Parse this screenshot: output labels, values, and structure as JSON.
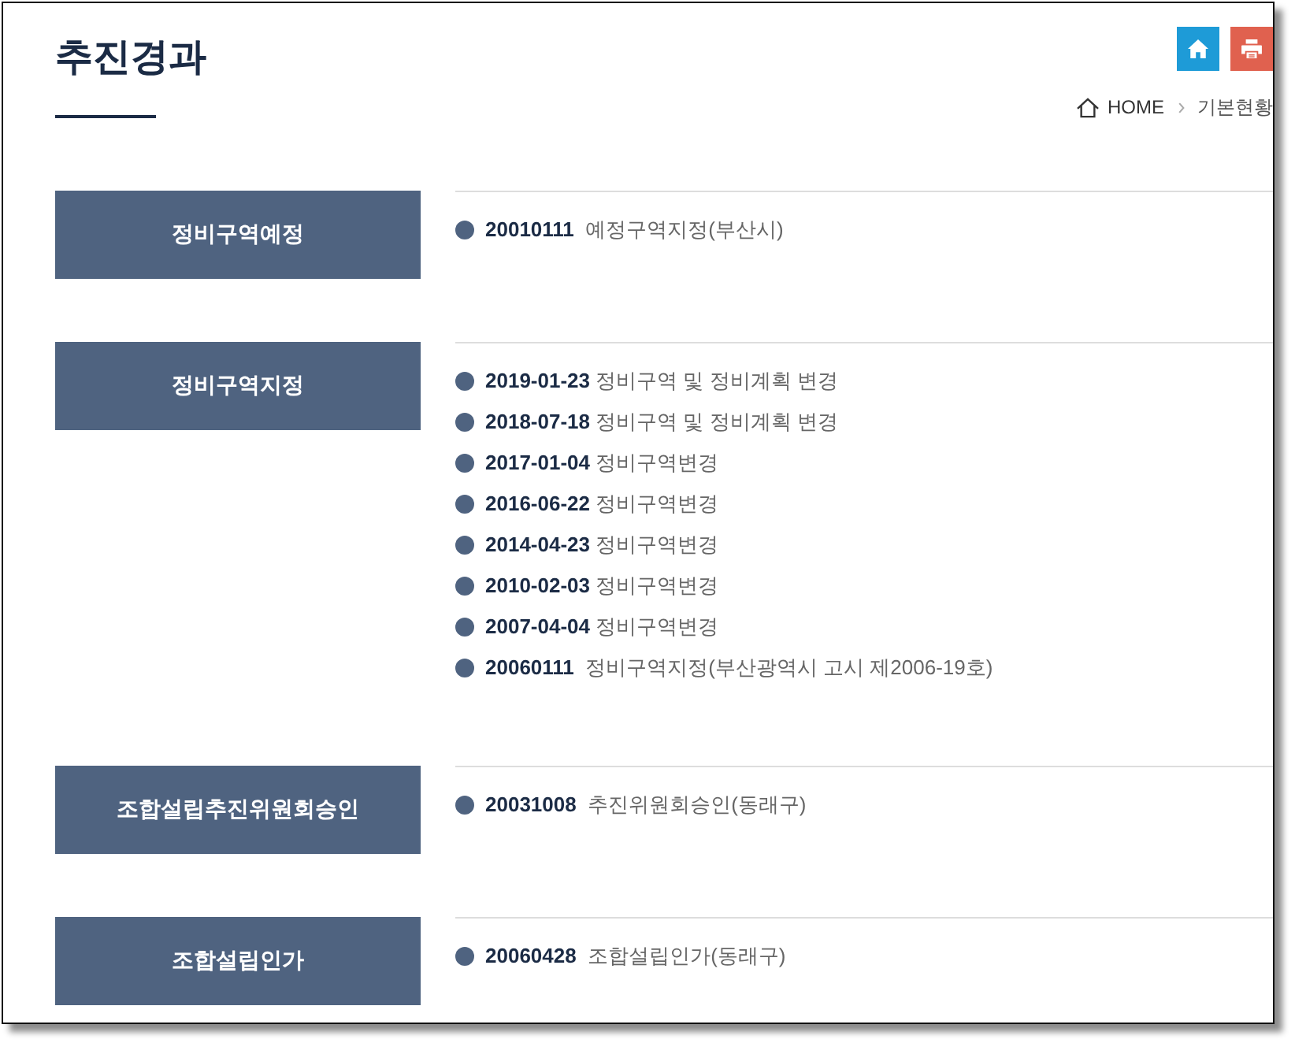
{
  "page": {
    "title": "추진경과"
  },
  "breadcrumb": [
    "HOME",
    "기본현황"
  ],
  "sections": [
    {
      "label": "정비구역예정",
      "entries": [
        "**20010111**  예정구역지정(부산시)"
      ]
    },
    {
      "label": "정비구역지정",
      "entries": [
        "**2019-01-23** 정비구역 및 정비계획 변경",
        "**2018-07-18** 정비구역 및 정비계획 변경",
        "**2017-01-04** 정비구역변경",
        "**2016-06-22** 정비구역변경",
        "**2014-04-23** 정비구역변경",
        "**2010-02-03** 정비구역변경",
        "**2007-04-04** 정비구역변경",
        "**20060111**  정비구역지정(부산광역시 고시 제2006-19호)"
      ]
    },
    {
      "label": "조합설립추진위원회승인",
      "entries": [
        "**20031008**  추진위원회승인(동래구)"
      ]
    },
    {
      "label": "조합설립인가",
      "entries": [
        "**20060428**  조합설립인가(동래구)"
      ]
    }
  ]
}
